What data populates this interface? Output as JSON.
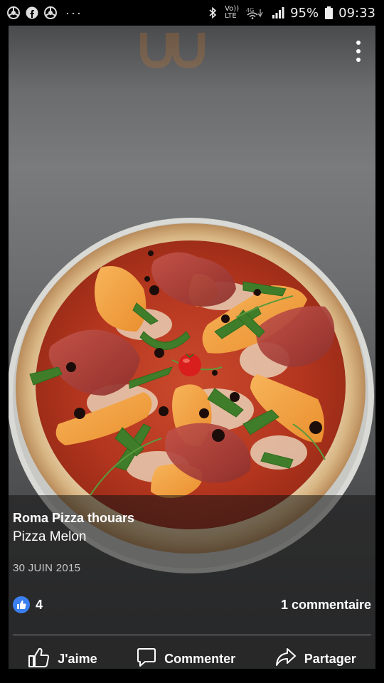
{
  "status_bar": {
    "left_icons": [
      "chrome-icon",
      "facebook-icon",
      "chrome-icon",
      "more-notifications-icon"
    ],
    "dots": "···",
    "volte": "Vo)) LTE",
    "network": "4G",
    "battery": "95%",
    "time": "09:33"
  },
  "post": {
    "author": "Roma Pizza thouars",
    "text": "Pizza Melon",
    "date": "30 JUIN 2015",
    "likes": "4",
    "comments": "1 commentaire"
  },
  "actions": {
    "like_label": "J'aime",
    "comment_label": "Commenter",
    "share_label": "Partager"
  },
  "colors": {
    "like_blue": "#3b7ff0",
    "caption_overlay": "rgba(20,20,20,0.55)"
  }
}
